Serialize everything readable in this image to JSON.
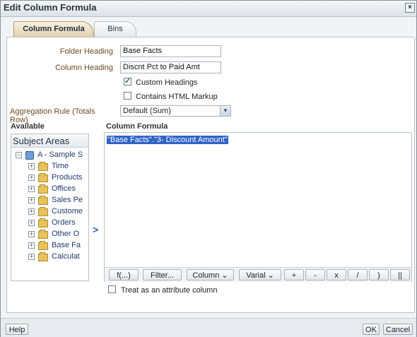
{
  "dialog": {
    "title": "Edit Column Formula",
    "close_icon": "close-icon"
  },
  "tabs": [
    {
      "label": "Column Formula",
      "active": true
    },
    {
      "label": "Bins",
      "active": false
    }
  ],
  "form": {
    "folder_heading_label": "Folder Heading",
    "folder_heading_value": "Base Facts",
    "column_heading_label": "Column Heading",
    "column_heading_value": "Discnt Pct to Paid Amt",
    "custom_headings_label": "Custom Headings",
    "custom_headings_checked": true,
    "html_markup_label": "Contains HTML Markup",
    "html_markup_checked": false,
    "aggregation_label": "Aggregation Rule (Totals Row)",
    "aggregation_value": "Default (Sum)"
  },
  "available": {
    "heading": "Available",
    "subject_areas_title": "Subject Areas",
    "root": {
      "label": "A - Sample S",
      "icon": "cube-icon"
    },
    "items": [
      {
        "label": "Time"
      },
      {
        "label": "Products"
      },
      {
        "label": "Offices"
      },
      {
        "label": "Sales Pe"
      },
      {
        "label": "Custome"
      },
      {
        "label": "Orders"
      },
      {
        "label": "Other O"
      },
      {
        "label": "Base Fa"
      },
      {
        "label": "Calculat"
      }
    ]
  },
  "column_formula": {
    "heading": "Column Formula",
    "text": "\"Base Facts\".\"3- Discount Amount\"",
    "toolbar": [
      "f(...)",
      "Filter...",
      "Column ⌄",
      "Varial ⌄",
      "+",
      "-",
      "x",
      "/",
      ")",
      "||"
    ]
  },
  "attribute_column_label": "Treat as an attribute column",
  "buttons": {
    "help": "Help",
    "ok": "OK",
    "cancel": "Cancel"
  }
}
